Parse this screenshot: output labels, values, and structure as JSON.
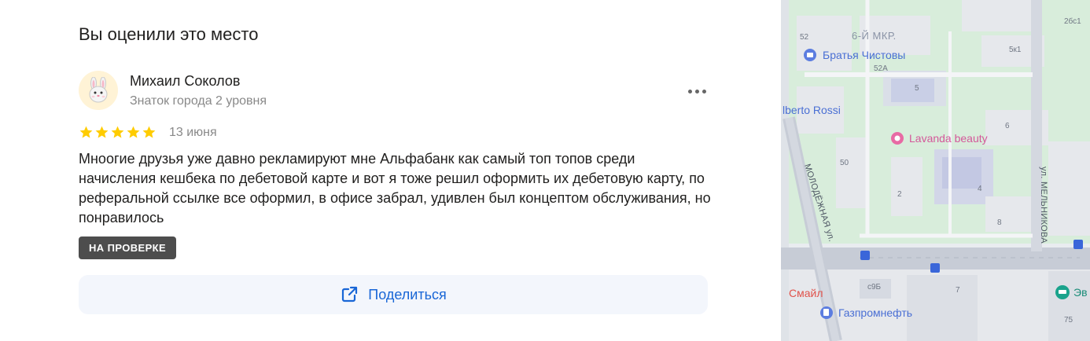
{
  "review_panel": {
    "title": "Вы оценили это место",
    "author": {
      "name": "Михаил Соколов",
      "level": "Знаток города 2 уровня",
      "avatar_icon": "bunny-avatar-icon"
    },
    "rating": 5,
    "date": "13 июня",
    "text": "Мноогие друзья уже давно рекламируют мне Альфабанк как самый топ топов среди начисления кешбека по дебетовой карте и вот я тоже решил оформить их дебетовую карту, по реферальной ссылке все оформил, в офисе забрал, удивлен был концептом обслуживания, но понравилось",
    "status_badge": "НА ПРОВЕРКЕ",
    "share_label": "Поделиться",
    "more_icon": "more-dots-icon"
  },
  "map": {
    "district": "6-Й МКР.",
    "pois": [
      {
        "name": "Братья Чистовы",
        "icon": "briefcase-icon",
        "color": "#5c7de0"
      },
      {
        "name": "lberto Rossi",
        "color": "#4a6fd4"
      },
      {
        "name": "Lavanda beauty",
        "icon": "lotus-icon",
        "color": "#e86aa4"
      },
      {
        "name": "Смайл",
        "color": "#e0524b"
      },
      {
        "name": "Газпромнефть",
        "icon": "fuel-icon",
        "color": "#5c7de0"
      },
      {
        "name": "Эв",
        "icon": "car-icon",
        "color": "#1aa38c"
      }
    ],
    "streets": [
      "МОЛОДЁЖНАЯ ул.",
      "ул. МЕЛЬНИКОВА"
    ],
    "house_numbers": [
      "52",
      "52А",
      "5",
      "5к1",
      "2бс1",
      "6",
      "50",
      "4",
      "2",
      "8",
      "с9Б",
      "7",
      "75"
    ]
  },
  "colors": {
    "accent": "#1866d6",
    "star": "#ffcc00",
    "badge_bg": "#4d4d4d",
    "share_bg": "#f3f6fc"
  }
}
